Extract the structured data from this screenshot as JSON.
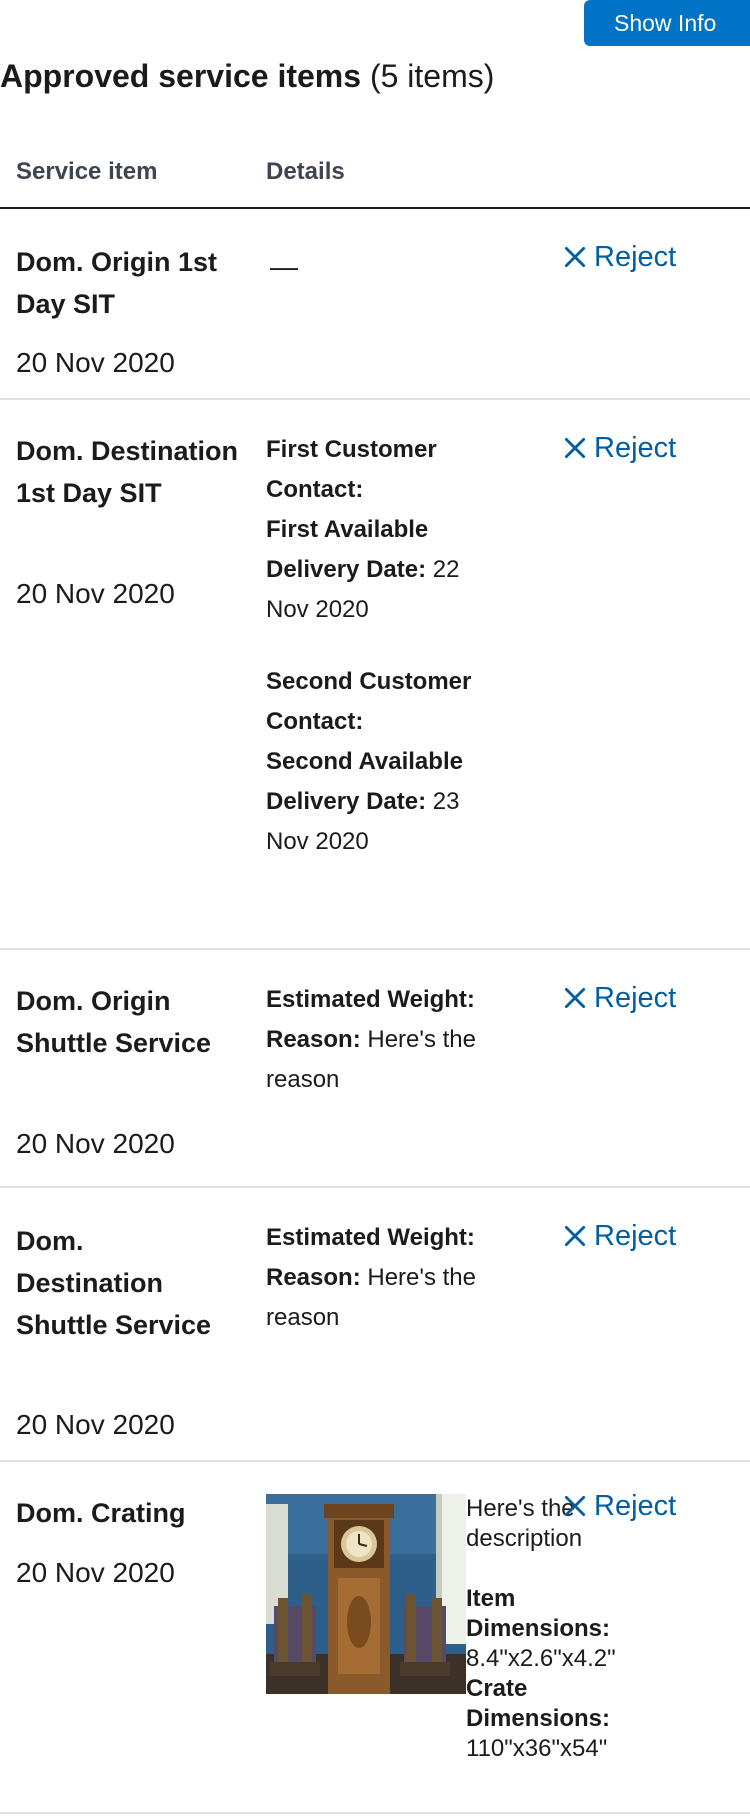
{
  "header": {
    "show_info_label": "Show Info",
    "title": "Approved service items",
    "count": "(5 items)"
  },
  "table": {
    "columns": [
      "Service item",
      "Details"
    ],
    "reject_label": "Reject",
    "rows": [
      {
        "name": "Dom. Origin 1st Day SIT",
        "date": "20 Nov 2020",
        "empty_details": "—"
      },
      {
        "name": "Dom. Destination 1st Day SIT",
        "date": "20 Nov 2020",
        "first_contact_label": "First Customer Contact:",
        "first_delivery_label": "First Available Delivery Date:",
        "first_delivery_value": "22 Nov 2020",
        "second_contact_label": "Second Customer Contact:",
        "second_delivery_label": "Second Available Delivery Date:",
        "second_delivery_value": "23 Nov 2020"
      },
      {
        "name": "Dom. Origin Shuttle Service",
        "date": "20 Nov 2020",
        "weight_label": "Estimated Weight:",
        "reason_label": "Reason:",
        "reason_value": "Here's the reason"
      },
      {
        "name": "Dom. Destination Shuttle Service",
        "date": "20 Nov 2020",
        "weight_label": "Estimated Weight:",
        "reason_label": "Reason:",
        "reason_value": "Here's the reason"
      },
      {
        "name": "Dom. Crating",
        "date": "20 Nov 2020",
        "description": "Here's the description",
        "item_dimensions_label": "Item Dimensions:",
        "item_dimensions_value": "8.4\"x2.6\"x4.2\"",
        "crate_dimensions_label": "Crate Dimensions:",
        "crate_dimensions_value": "110\"x36\"x54\""
      }
    ]
  },
  "colors": {
    "primary_button": "#0073c7",
    "link": "#005ea2",
    "row_divider": "#dfe1e2"
  },
  "icons": {
    "reject": "close-icon"
  }
}
